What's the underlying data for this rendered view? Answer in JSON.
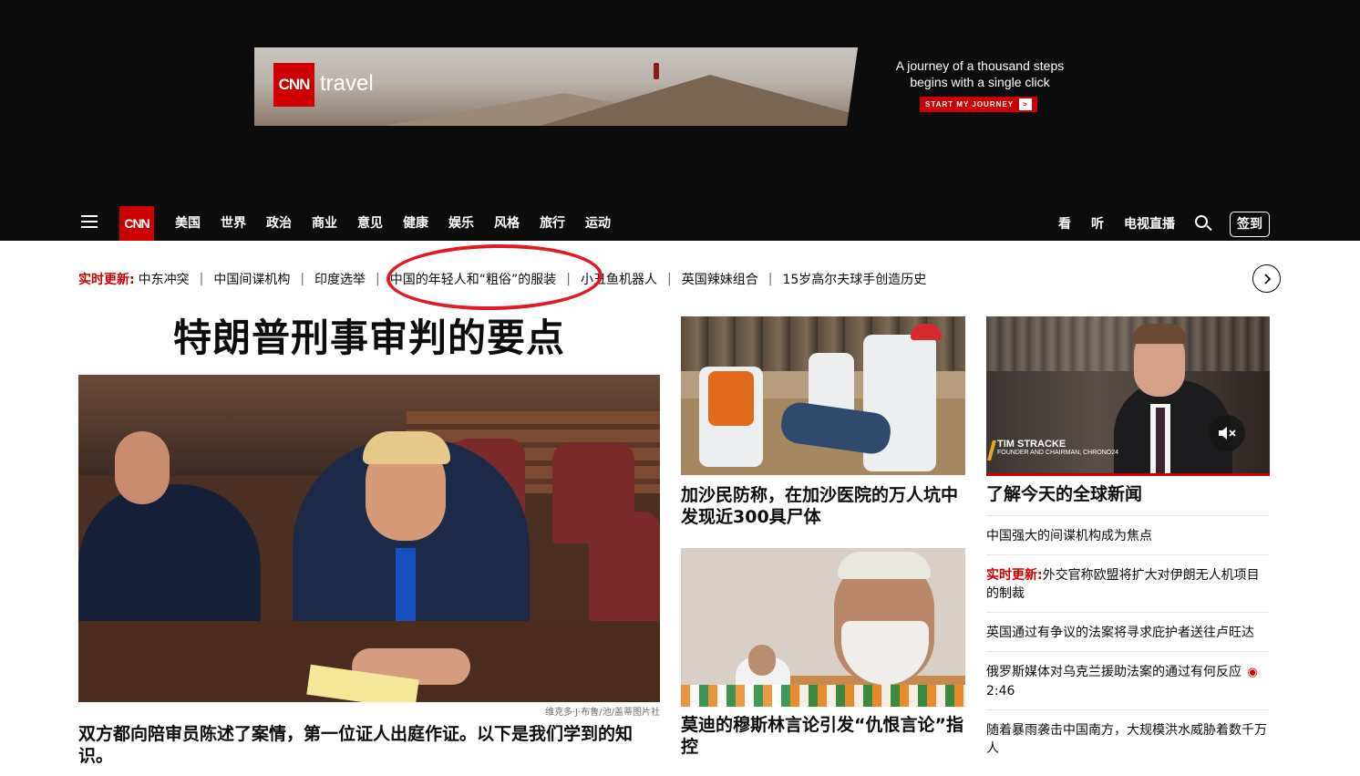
{
  "ad": {
    "logo": "CNN",
    "brand": "travel",
    "copy_line1": "A journey of a thousand steps",
    "copy_line2": "begins with a single click",
    "cta": "START MY JOURNEY",
    "cta_arrow": ">"
  },
  "nav": {
    "logo": "CNN",
    "links": [
      "美国",
      "世界",
      "政治",
      "商业",
      "意见",
      "健康",
      "娱乐",
      "风格",
      "旅行",
      "运动"
    ],
    "right": [
      "看",
      "听",
      "电视直播"
    ],
    "signin": "签到"
  },
  "ticker": {
    "label": "实时更新:",
    "items": [
      "中东冲突",
      "中国间谍机构",
      "印度选举",
      "中国的年轻人和“粗俗”的服装",
      "小丑鱼机器人",
      "英国辣妹组合",
      "15岁高尔夫球手创造历史"
    ],
    "sep": "|"
  },
  "main": {
    "headline": "特朗普刑事审判的要点",
    "credit": "维克多·J·布鲁/池/盖蒂图片社",
    "subhead": "双方都向陪审员陈述了案情，第一位证人出庭作证。以下是我们学到的知识。"
  },
  "middle": {
    "story1_title": "加沙民防称，在加沙医院的万人坑中发现近300具尸体",
    "story2_title": "莫迪的穆斯林言论引发“仇恨言论”指控"
  },
  "video": {
    "name": "TIM STRACKE",
    "role": "FOUNDER AND CHAIRMAN, CHRONO24"
  },
  "right": {
    "title": "了解今天的全球新闻",
    "rows": [
      {
        "live": "",
        "text": "中国强大的间谍机构成为焦点",
        "duration": ""
      },
      {
        "live": "实时更新:",
        "text": "外交官称欧盟将扩大对伊朗无人机项目的制裁",
        "duration": ""
      },
      {
        "live": "",
        "text": "英国通过有争议的法案将寻求庇护者送往卢旺达",
        "duration": ""
      },
      {
        "live": "",
        "text": "俄罗斯媒体对乌克兰援助法案的通过有何反应",
        "duration": "2:46"
      },
      {
        "live": "",
        "text": "随着暴雨袭击中国南方，大规模洪水威胁着数千万人",
        "duration": ""
      }
    ]
  },
  "colors": {
    "brand_red": "#cc0000",
    "nav_bg": "#0c0c0c",
    "annotation_circle": "#e01b24"
  }
}
